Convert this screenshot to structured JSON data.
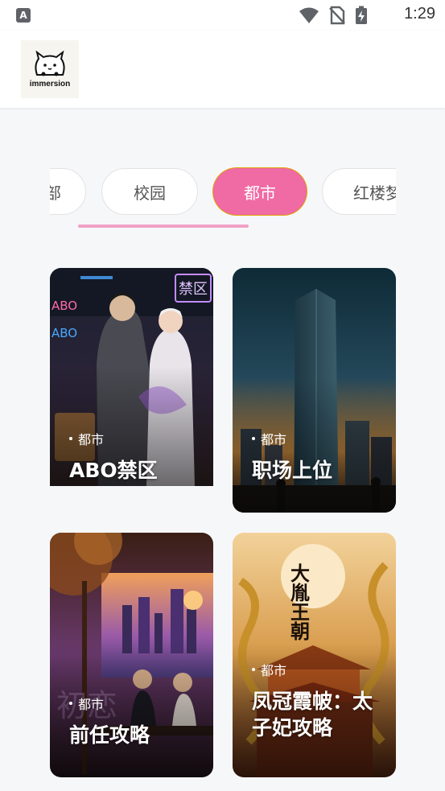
{
  "status_bar": {
    "notification_badge": "A",
    "time": "1:29",
    "icons": [
      "wifi-icon",
      "no-sim-icon",
      "battery-charging-icon"
    ]
  },
  "header": {
    "logo_text": "immersion"
  },
  "tabs": [
    {
      "label": "…部"
    },
    {
      "label": "校园"
    },
    {
      "label": "都市"
    },
    {
      "label": "红楼梦"
    }
  ],
  "active_tab": "都市",
  "cards": [
    {
      "tag": "都市",
      "title": "ABO禁区",
      "sign_text": "禁区",
      "neon_text": [
        "ABO",
        "ABO"
      ]
    },
    {
      "tag": "都市",
      "title": "职场上位"
    },
    {
      "tag": "都市",
      "title": "前任攻略",
      "watermark_text": "初恋"
    },
    {
      "tag": "都市",
      "title": "凤冠霞帔：太子妃攻略",
      "poster_text": "大胤王朝"
    }
  ],
  "colors": {
    "accent": "#f06aa4",
    "indicator": "#f1a1c6",
    "background": "#f6f7f9"
  }
}
